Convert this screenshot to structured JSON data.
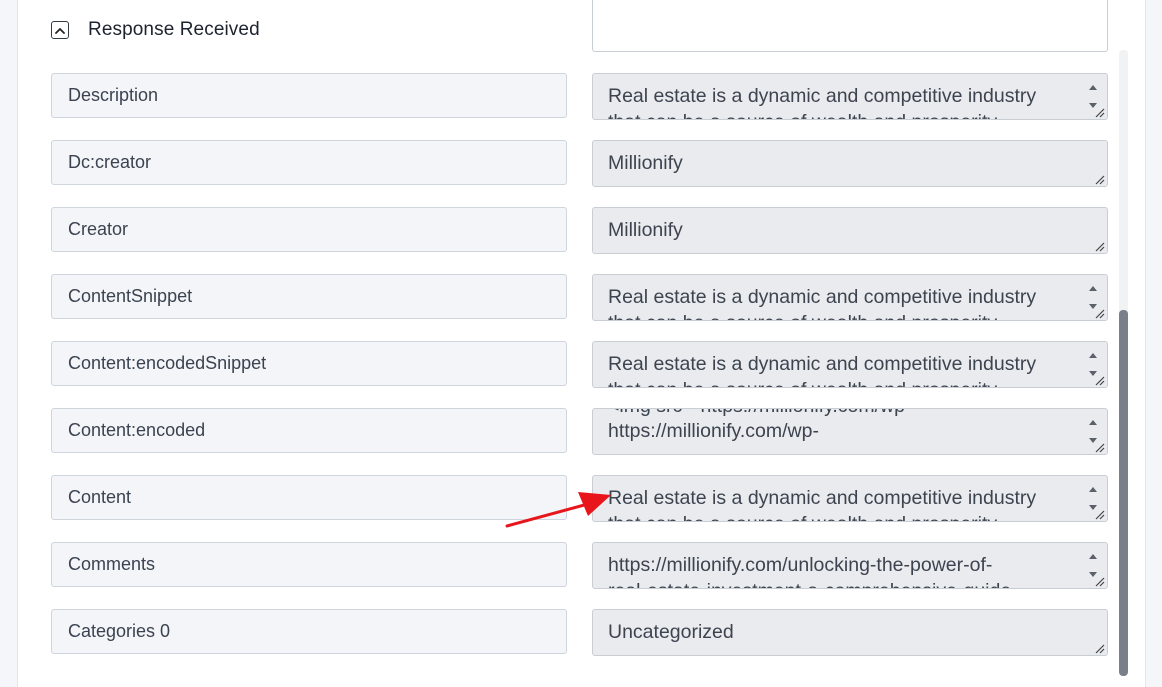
{
  "section": {
    "title": "Response Received"
  },
  "fields": [
    {
      "label": "Description",
      "value": "Real estate is a dynamic and competitive industry",
      "ghost": "that can be a source of wealth and prosperity",
      "scroll": true
    },
    {
      "label": "Dc:creator",
      "value": "Millionify",
      "scroll": false
    },
    {
      "label": "Creator",
      "value": "Millionify",
      "scroll": false
    },
    {
      "label": "ContentSnippet",
      "value": "Real estate is a dynamic and competitive industry",
      "ghost": "that can be a source of wealth and prosperity",
      "scroll": true
    },
    {
      "label": "Content:encodedSnippet",
      "value": "Real estate is a dynamic and competitive industry",
      "ghost": "that can be a source of wealth and prosperity",
      "scroll": true
    },
    {
      "label": "Content:encoded",
      "value": "https://millionify.com/wp-",
      "ghost_top": "<img src=\"https://millionify.com/wp-",
      "scroll": true
    },
    {
      "label": "Content",
      "value": "Real estate is a dynamic and competitive industry",
      "ghost": "that can be a source of wealth and prosperity",
      "scroll": true
    },
    {
      "label": "Comments",
      "value": "https://millionify.com/unlocking-the-power-of-",
      "ghost": "real-estate-investment-a-comprehensive-guide",
      "scroll": true
    },
    {
      "label": "Categories 0",
      "value": "Uncategorized",
      "scroll": false
    }
  ],
  "colors": {
    "annotation_arrow": "#e8161b",
    "scroll_thumb": "#7a8089"
  }
}
